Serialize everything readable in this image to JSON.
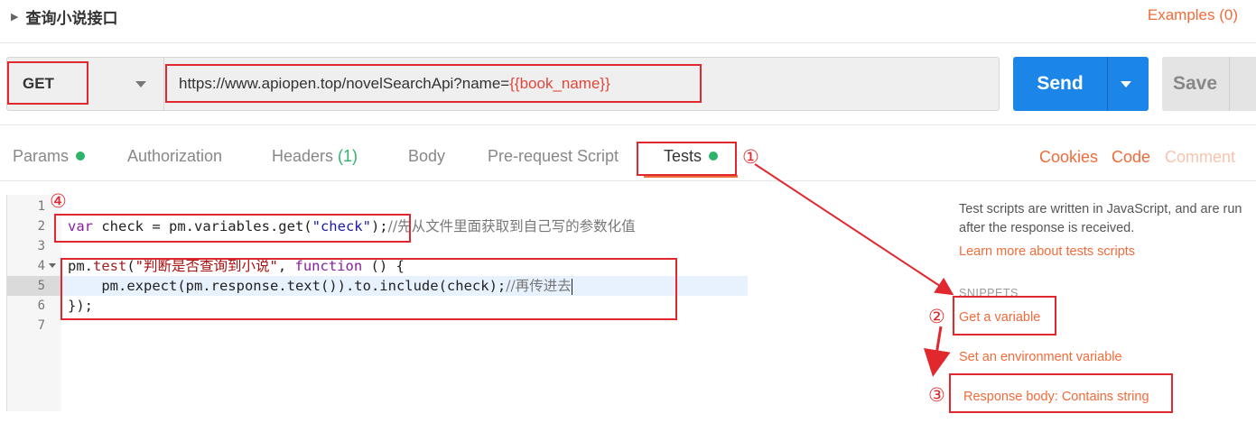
{
  "request": {
    "title": "查询小说接口",
    "examples_label": "Examples (0)",
    "method": "GET",
    "url_base": "https://www.apiopen.top/novelSearchApi?name=",
    "url_variable": "{{book_name}}",
    "send_label": "Send",
    "save_label": "Save"
  },
  "tabs": [
    {
      "label": "Params",
      "indicator": "green-dot"
    },
    {
      "label": "Authorization"
    },
    {
      "label": "Headers",
      "count": "(1)"
    },
    {
      "label": "Body"
    },
    {
      "label": "Pre-request Script"
    },
    {
      "label": "Tests",
      "indicator": "green-dot",
      "active": true
    }
  ],
  "right_links": {
    "cookies": "Cookies",
    "code": "Code",
    "comments": "Comment"
  },
  "editor": {
    "lines": [
      {
        "num": "1"
      },
      {
        "num": "2",
        "segments": [
          "var",
          " check = pm.variables.get(",
          "\"check\"",
          ");",
          "//先从文件里面获取到自己写的参数化值"
        ]
      },
      {
        "num": "3"
      },
      {
        "num": "4",
        "segments": [
          "pm.",
          "test",
          "(",
          "\"判断是否查询到小说\"",
          ", ",
          "function",
          " () {"
        ]
      },
      {
        "num": "5",
        "segments": [
          "    pm.expect(pm.response.text()).to.include(check);",
          "//再传进去"
        ]
      },
      {
        "num": "6",
        "segments": [
          "});"
        ]
      },
      {
        "num": "7"
      }
    ]
  },
  "sidebar": {
    "description": "Test scripts are written in JavaScript, and are run after the response is received.",
    "learn_more": "Learn more about tests scripts",
    "snippets_heading": "SNIPPETS",
    "snippets": [
      "Get a variable",
      "Set an environment variable",
      "Response body: Contains string"
    ]
  },
  "annotations": {
    "markers": [
      "①",
      "②",
      "③",
      "④"
    ],
    "color": "#e0282e"
  },
  "colors": {
    "accent": "#f26b3a",
    "send": "#1c86e8",
    "indicator": "#2db36a"
  }
}
